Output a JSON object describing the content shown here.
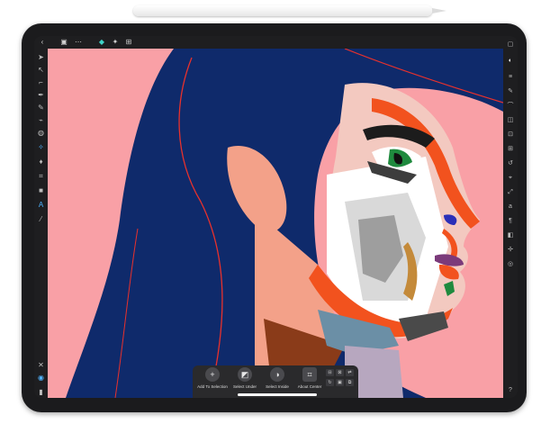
{
  "app": {
    "accent": "#3fd2c7",
    "selection": "#4fb3ff"
  },
  "top_toolbar": {
    "left_icons": [
      "back-icon",
      "document-icon",
      "more-icon",
      "pixel-persona-icon",
      "settings-icon",
      "export-icon"
    ]
  },
  "left_tools": [
    "move-icon",
    "node-icon",
    "corner-icon",
    "pen-icon",
    "pencil-icon",
    "brush-icon",
    "pressure-icon",
    "fill-icon",
    "transparency-icon",
    "crop-icon",
    "shape-icon",
    "text-icon",
    "eyedropper-icon"
  ],
  "right_studio": [
    "layers-icon",
    "swatches-icon",
    "brushes-icon",
    "color-icon",
    "stroke-icon",
    "effects-icon",
    "styles-icon",
    "grid-icon",
    "history-icon",
    "navigator-icon",
    "transform-icon",
    "character-icon",
    "paragraph-icon",
    "symbols-icon",
    "constraints-icon",
    "help-icon"
  ],
  "context_toolbar": {
    "add_to_selection": "Add To Selection",
    "select_under": "Select Under",
    "select_inside": "Select Inside",
    "about_center": "About Center"
  },
  "bottom_left": {
    "help_label": "?"
  }
}
